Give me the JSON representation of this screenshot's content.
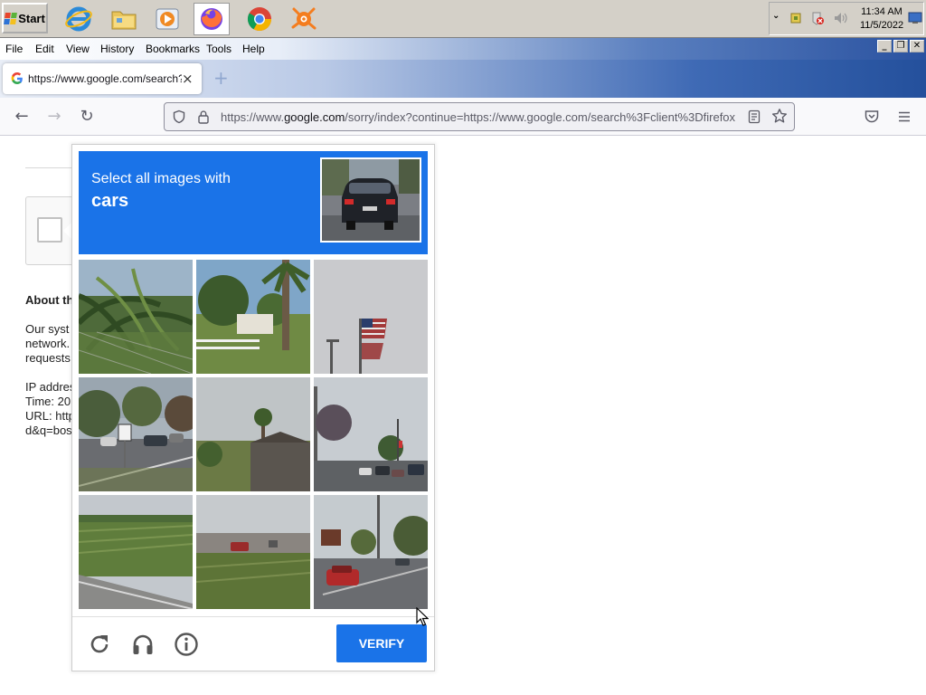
{
  "taskbar": {
    "start_label": "Start",
    "quick_launch": [
      "internet-explorer",
      "file-explorer",
      "media-player",
      "firefox",
      "chrome",
      "avast"
    ],
    "clock_time": "11:34 AM",
    "clock_date": "11/5/2022"
  },
  "browser": {
    "menu": [
      "File",
      "Edit",
      "View",
      "History",
      "Bookmarks",
      "Tools",
      "Help"
    ],
    "tab_title": "https://www.google.com/search?cl",
    "url_prefix": "https://www.",
    "url_domain": "google.com",
    "url_rest": "/sorry/index?continue=https://www.google.com/search%3Fclient%3Dfirefox"
  },
  "background_page": {
    "heading": "About th",
    "lines": [
      "Our syst",
      "network.",
      "requests",
      "IP addres",
      "Time: 20",
      "URL: http",
      "d&q=bos"
    ]
  },
  "captcha": {
    "instruction": "Select all images with",
    "target": "cars",
    "verify_label": "VERIFY",
    "tiles": [
      "palm-fronds-chainlink-fence",
      "palm-trees-white-fence-house",
      "american-flag-pole",
      "road-sign-parked-cars",
      "palm-tree-building",
      "street-intersection-cars",
      "grass-field-road",
      "field-red-car",
      "street-red-car"
    ],
    "icons": [
      "reload-icon",
      "audio-icon",
      "info-icon"
    ]
  },
  "colors": {
    "captcha_blue": "#1a73e8",
    "taskbar": "#d4d0c8"
  }
}
